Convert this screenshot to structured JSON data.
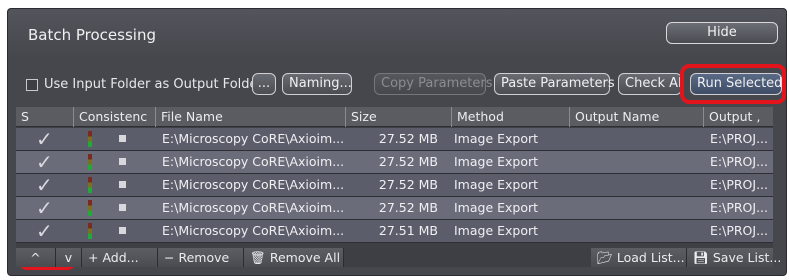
{
  "panel": {
    "title": "Batch Processing",
    "hide_label": "Hide"
  },
  "toolbar": {
    "use_input_folder_label": "Use Input Folder as Output Folder",
    "use_input_folder_checked": false,
    "browse_label": "...",
    "naming_label": "Naming...",
    "copy_parameters_label": "Copy Parameters",
    "paste_parameters_label": "Paste Parameters",
    "check_all_label": "Check All",
    "run_selected_label": "Run Selected"
  },
  "table": {
    "columns": [
      "S",
      "Consistenc",
      "File Name",
      "Size",
      "Method",
      "Output Name",
      "Output ‚"
    ],
    "rows": [
      {
        "selected": "✓",
        "file_name": "E:\\Microscopy CoRE\\Axioim...",
        "size": "27.52 MB",
        "method": "Image Export",
        "output_name": "",
        "output_folder": "E:\\PROJ..."
      },
      {
        "selected": "✓",
        "file_name": "E:\\Microscopy CoRE\\Axioim...",
        "size": "27.52 MB",
        "method": "Image Export",
        "output_name": "",
        "output_folder": "E:\\PROJ..."
      },
      {
        "selected": "✓",
        "file_name": "E:\\Microscopy CoRE\\Axioim...",
        "size": "27.52 MB",
        "method": "Image Export",
        "output_name": "",
        "output_folder": "E:\\PROJ..."
      },
      {
        "selected": "✓",
        "file_name": "E:\\Microscopy CoRE\\Axioim...",
        "size": "27.52 MB",
        "method": "Image Export",
        "output_name": "",
        "output_folder": "E:\\PROJ..."
      },
      {
        "selected": "✓",
        "file_name": "E:\\Microscopy CoRE\\Axioim...",
        "size": "27.51 MB",
        "method": "Image Export",
        "output_name": "",
        "output_folder": "E:\\PROJ..."
      }
    ]
  },
  "bottom": {
    "up_label": "^",
    "down_label": "v",
    "add_label": "+ Add...",
    "remove_label": "− Remove",
    "remove_all_label": "Remove All",
    "load_list_label": "Load List...",
    "save_list_label": "Save List..."
  },
  "colors": {
    "highlight": "#e3141c",
    "panel_bg": "#45474d"
  }
}
